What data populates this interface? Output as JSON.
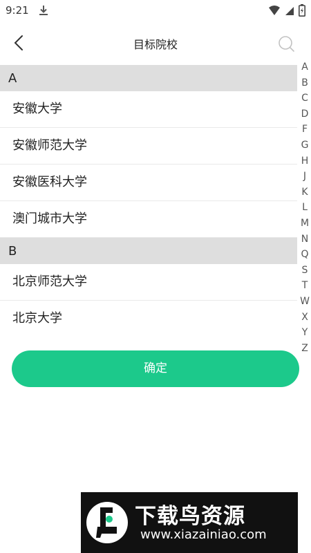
{
  "status_bar": {
    "time": "9:21"
  },
  "header": {
    "title": "目标院校"
  },
  "sections": [
    {
      "letter": "A",
      "items": [
        "安徽大学",
        "安徽师范大学",
        "安徽医科大学",
        "澳门城市大学"
      ]
    },
    {
      "letter": "B",
      "items": [
        "北京师范大学",
        "北京大学"
      ]
    }
  ],
  "index_letters": [
    "A",
    "B",
    "C",
    "D",
    "F",
    "G",
    "H",
    "J",
    "K",
    "L",
    "M",
    "N",
    "Q",
    "S",
    "T",
    "W",
    "X",
    "Y",
    "Z"
  ],
  "confirm_label": "确定",
  "watermark": {
    "title": "下载鸟资源",
    "url": "www.xiazainiao.com"
  },
  "colors": {
    "accent": "#1cc98b",
    "section_bg": "#dedede"
  }
}
